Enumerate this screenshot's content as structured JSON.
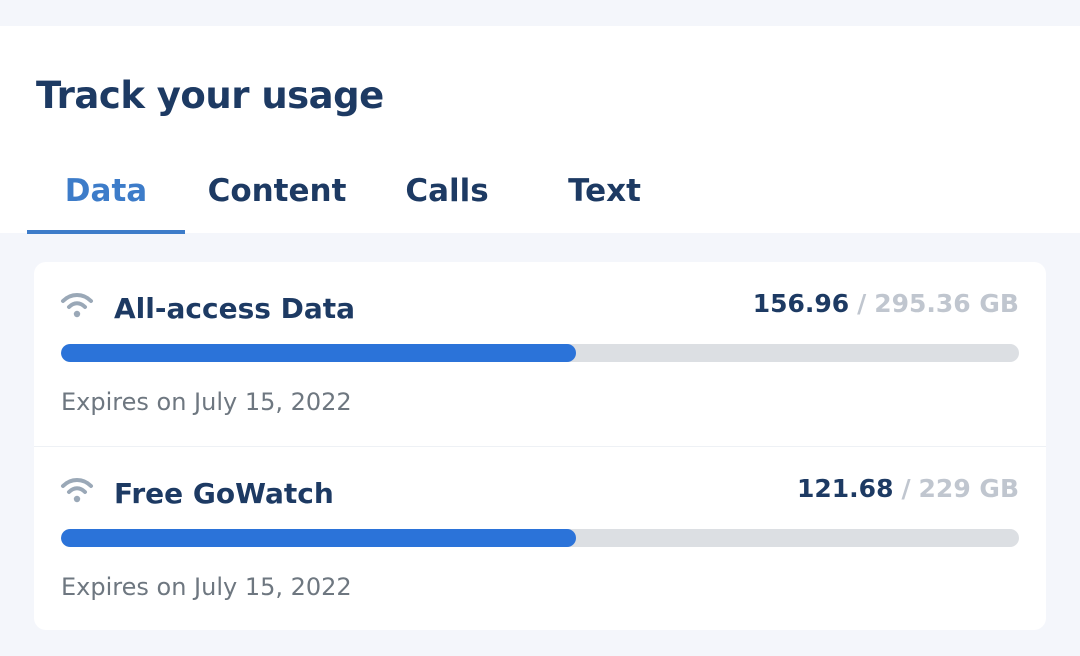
{
  "title": "Track your usage",
  "tabs": [
    {
      "label": "Data",
      "active": true
    },
    {
      "label": "Content",
      "active": false
    },
    {
      "label": "Calls",
      "active": false
    },
    {
      "label": "Text",
      "active": false
    }
  ],
  "usage_items": [
    {
      "icon": "wifi-icon",
      "name": "All-access Data",
      "used": "156.96",
      "separator": "/",
      "total": "295.36 GB",
      "progress": 0.538,
      "expiry": "Expires on July 15, 2022"
    },
    {
      "icon": "wifi-icon",
      "name": "Free GoWatch",
      "used": "121.68",
      "separator": "/",
      "total": "229 GB",
      "progress": 0.538,
      "expiry": "Expires on July 15, 2022"
    }
  ],
  "colors": {
    "background": "#f4f6fb",
    "panel": "#ffffff",
    "title": "#1d3a63",
    "active_tab": "#3d7cc9",
    "progress_fill": "#2b73d9",
    "progress_track": "#dcdfe3",
    "muted_text": "#6e7780",
    "total_text": "#c0c6cf"
  }
}
